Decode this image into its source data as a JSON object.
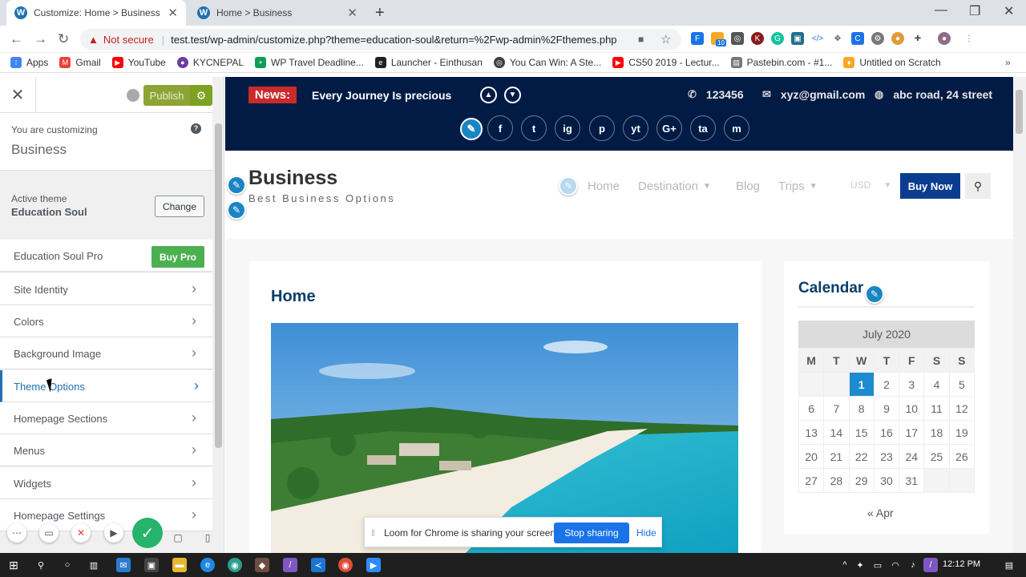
{
  "browser": {
    "tabs": [
      {
        "title": "Customize: Home > Business"
      },
      {
        "title": "Home > Business"
      }
    ],
    "new_tab": "+",
    "not_secure": "Not secure",
    "url": "test.test/wp-admin/customize.php?theme=education-soul&return=%2Fwp-admin%2Fthemes.php",
    "bookmarks": [
      {
        "label": "Apps",
        "color": "#4285f4"
      },
      {
        "label": "Gmail",
        "color": "#ea4335"
      },
      {
        "label": "YouTube",
        "color": "#ff0000"
      },
      {
        "label": "KYCNEPAL",
        "color": "#6b3fa0"
      },
      {
        "label": "WP Travel Deadline...",
        "color": "#0f9d58"
      },
      {
        "label": "Launcher - Einthusan",
        "color": "#222222"
      },
      {
        "label": "You Can Win: A Ste...",
        "color": "#3c4043"
      },
      {
        "label": "CS50 2019 - Lectur...",
        "color": "#ff0000"
      },
      {
        "label": "Pastebin.com - #1...",
        "color": "#777777"
      },
      {
        "label": "Untitled on Scratch",
        "color": "#f9a825"
      }
    ],
    "ext_badge": "10"
  },
  "customizer": {
    "publish_label": "Publish",
    "you_are_customizing": "You are customizing",
    "site_name": "Business",
    "active_theme_label": "Active theme",
    "active_theme_name": "Education Soul",
    "change_label": "Change",
    "pro_label": "Education Soul Pro",
    "buy_pro_label": "Buy Pro",
    "menu": [
      {
        "label": "Site Identity"
      },
      {
        "label": "Colors"
      },
      {
        "label": "Background Image"
      },
      {
        "label": "Theme Options",
        "active": true
      },
      {
        "label": "Homepage Sections"
      },
      {
        "label": "Menus"
      },
      {
        "label": "Widgets"
      },
      {
        "label": "Homepage Settings"
      }
    ]
  },
  "site": {
    "news_label": "News:",
    "news_text": "Every Journey Is precious",
    "phone": "123456",
    "email": "xyz@gmail.com",
    "address": "abc road, 24 street",
    "social": [
      "f",
      "t",
      "ig",
      "p",
      "yt",
      "G+",
      "ta",
      "m"
    ],
    "title": "Business",
    "tagline": "Best Business Options",
    "nav": [
      {
        "label": "Home"
      },
      {
        "label": "Destination",
        "dropdown": true
      },
      {
        "label": "Blog"
      },
      {
        "label": "Trips",
        "dropdown": true
      },
      {
        "label": "USD",
        "dropdown": true
      }
    ],
    "buy_now": "Buy Now",
    "page_heading": "Home",
    "widget_title": "Calendar",
    "calendar": {
      "caption": "July 2020",
      "days": [
        "M",
        "T",
        "W",
        "T",
        "F",
        "S",
        "S"
      ],
      "weeks": [
        [
          "",
          "",
          "1",
          "2",
          "3",
          "4",
          "5"
        ],
        [
          "6",
          "7",
          "8",
          "9",
          "10",
          "11",
          "12"
        ],
        [
          "13",
          "14",
          "15",
          "16",
          "17",
          "18",
          "19"
        ],
        [
          "20",
          "21",
          "22",
          "23",
          "24",
          "25",
          "26"
        ],
        [
          "27",
          "28",
          "29",
          "30",
          "31",
          "",
          ""
        ]
      ],
      "today": "1",
      "prev": "« Apr"
    }
  },
  "loom": {
    "message": "Loom for Chrome is sharing your screen.",
    "stop_label": "Stop sharing",
    "hide_label": "Hide"
  },
  "taskbar": {
    "time": "12:12 PM"
  }
}
